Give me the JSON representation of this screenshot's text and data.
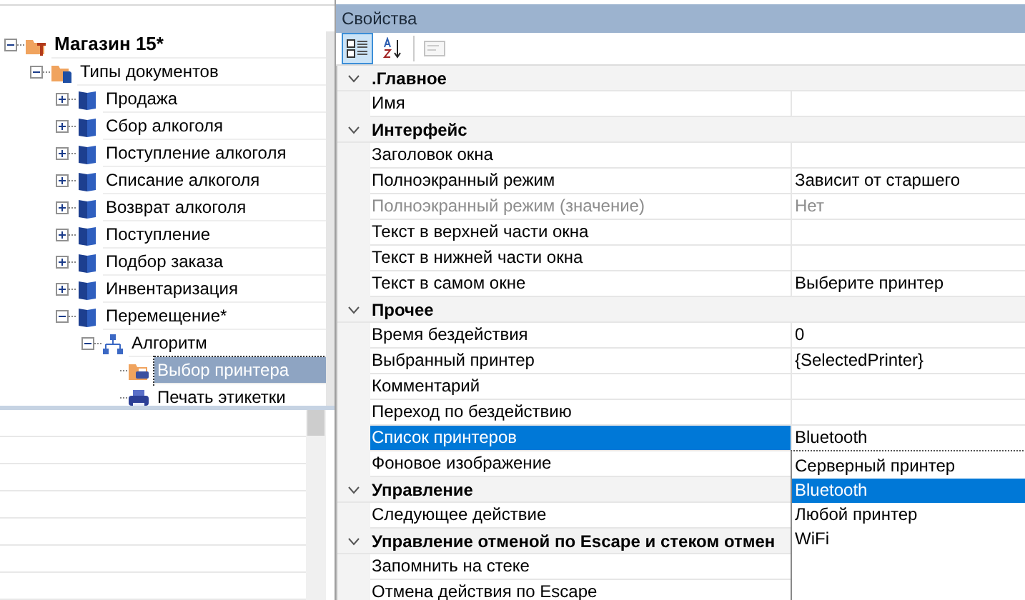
{
  "tree": [
    {
      "label": "Магазин 15*",
      "kind": "store",
      "expanded": true,
      "selected": false,
      "children": [
        {
          "label": "Типы документов",
          "kind": "folder",
          "expanded": true,
          "selected": false,
          "children": [
            {
              "label": "Продажа",
              "kind": "document",
              "expanded": false,
              "selected": false
            },
            {
              "label": "Сбор алкоголя",
              "kind": "document",
              "expanded": false,
              "selected": false
            },
            {
              "label": "Поступление алкоголя",
              "kind": "document",
              "expanded": false,
              "selected": false
            },
            {
              "label": "Списание алкоголя",
              "kind": "document",
              "expanded": false,
              "selected": false
            },
            {
              "label": "Возврат алкоголя",
              "kind": "document",
              "expanded": false,
              "selected": false
            },
            {
              "label": "Поступление",
              "kind": "document",
              "expanded": false,
              "selected": false
            },
            {
              "label": "Подбор заказа",
              "kind": "document",
              "expanded": false,
              "selected": false
            },
            {
              "label": "Инвентаризация",
              "kind": "document",
              "expanded": false,
              "selected": false
            },
            {
              "label": "Перемещение*",
              "kind": "document",
              "expanded": true,
              "selected": false,
              "children": [
                {
                  "label": "Алгоритм",
                  "kind": "algorithm",
                  "expanded": true,
                  "selected": false,
                  "children": [
                    {
                      "label": "Выбор принтера",
                      "kind": "select-step",
                      "selected": true
                    },
                    {
                      "label": "Печать этикетки",
                      "kind": "print-step",
                      "selected": false
                    }
                  ]
                }
              ]
            }
          ]
        }
      ]
    }
  ],
  "properties_panel": {
    "title": "Свойства",
    "toolbar": [
      {
        "kind": "categorized",
        "selected": true,
        "disabled": false
      },
      {
        "kind": "alphabetical",
        "selected": false,
        "disabled": false
      },
      {
        "kind": "pages",
        "selected": false,
        "disabled": true
      }
    ],
    "categories": [
      {
        "title": ".Главное",
        "expanded": true,
        "properties": [
          {
            "name": "Имя",
            "disabled": false,
            "selected": false
          }
        ]
      },
      {
        "title": "Интерфейс",
        "expanded": true,
        "properties": [
          {
            "name": "Заголовок окна",
            "disabled": false,
            "selected": false
          },
          {
            "name": "Полноэкранный режим",
            "value": "Зависит от старшего",
            "disabled": false,
            "selected": false
          },
          {
            "name": "Полноэкранный режим (значение)",
            "value": "Нет",
            "disabled": true,
            "selected": false
          },
          {
            "name": "Текст в верхней части окна",
            "disabled": false,
            "selected": false
          },
          {
            "name": "Текст в нижней части окна",
            "disabled": false,
            "selected": false
          },
          {
            "name": "Текст в самом окне",
            "value": "Выберите принтер",
            "disabled": false,
            "selected": false
          }
        ]
      },
      {
        "title": "Прочее",
        "expanded": true,
        "properties": [
          {
            "name": "Время бездействия",
            "value": "0",
            "disabled": false,
            "selected": false
          },
          {
            "name": "Выбранный принтер",
            "value": "{SelectedPrinter}",
            "disabled": false,
            "selected": false
          },
          {
            "name": "Комментарий",
            "disabled": false,
            "selected": false
          },
          {
            "name": "Переход по бездействию",
            "disabled": false,
            "selected": false
          },
          {
            "name": "Список принтеров",
            "value": "Bluetooth",
            "disabled": false,
            "selected": true
          },
          {
            "name": "Фоновое изображение",
            "disabled": false,
            "selected": false
          }
        ]
      },
      {
        "title": "Управление",
        "expanded": true,
        "properties": [
          {
            "name": "Следующее действие",
            "disabled": false,
            "selected": false
          }
        ]
      },
      {
        "title": "Управление отменой по Escape и стеком отмен",
        "expanded": true,
        "properties": [
          {
            "name": "Запомнить на стеке",
            "disabled": false,
            "selected": false
          },
          {
            "name": "Отмена действия по Escape",
            "disabled": false,
            "selected": false
          }
        ]
      }
    ],
    "dropdown": {
      "options": [
        {
          "label": "Серверный принтер",
          "selected": false
        },
        {
          "label": "Bluetooth",
          "selected": true
        },
        {
          "label": "Любой принтер",
          "selected": false
        },
        {
          "label": "WiFi",
          "selected": false
        }
      ]
    }
  }
}
